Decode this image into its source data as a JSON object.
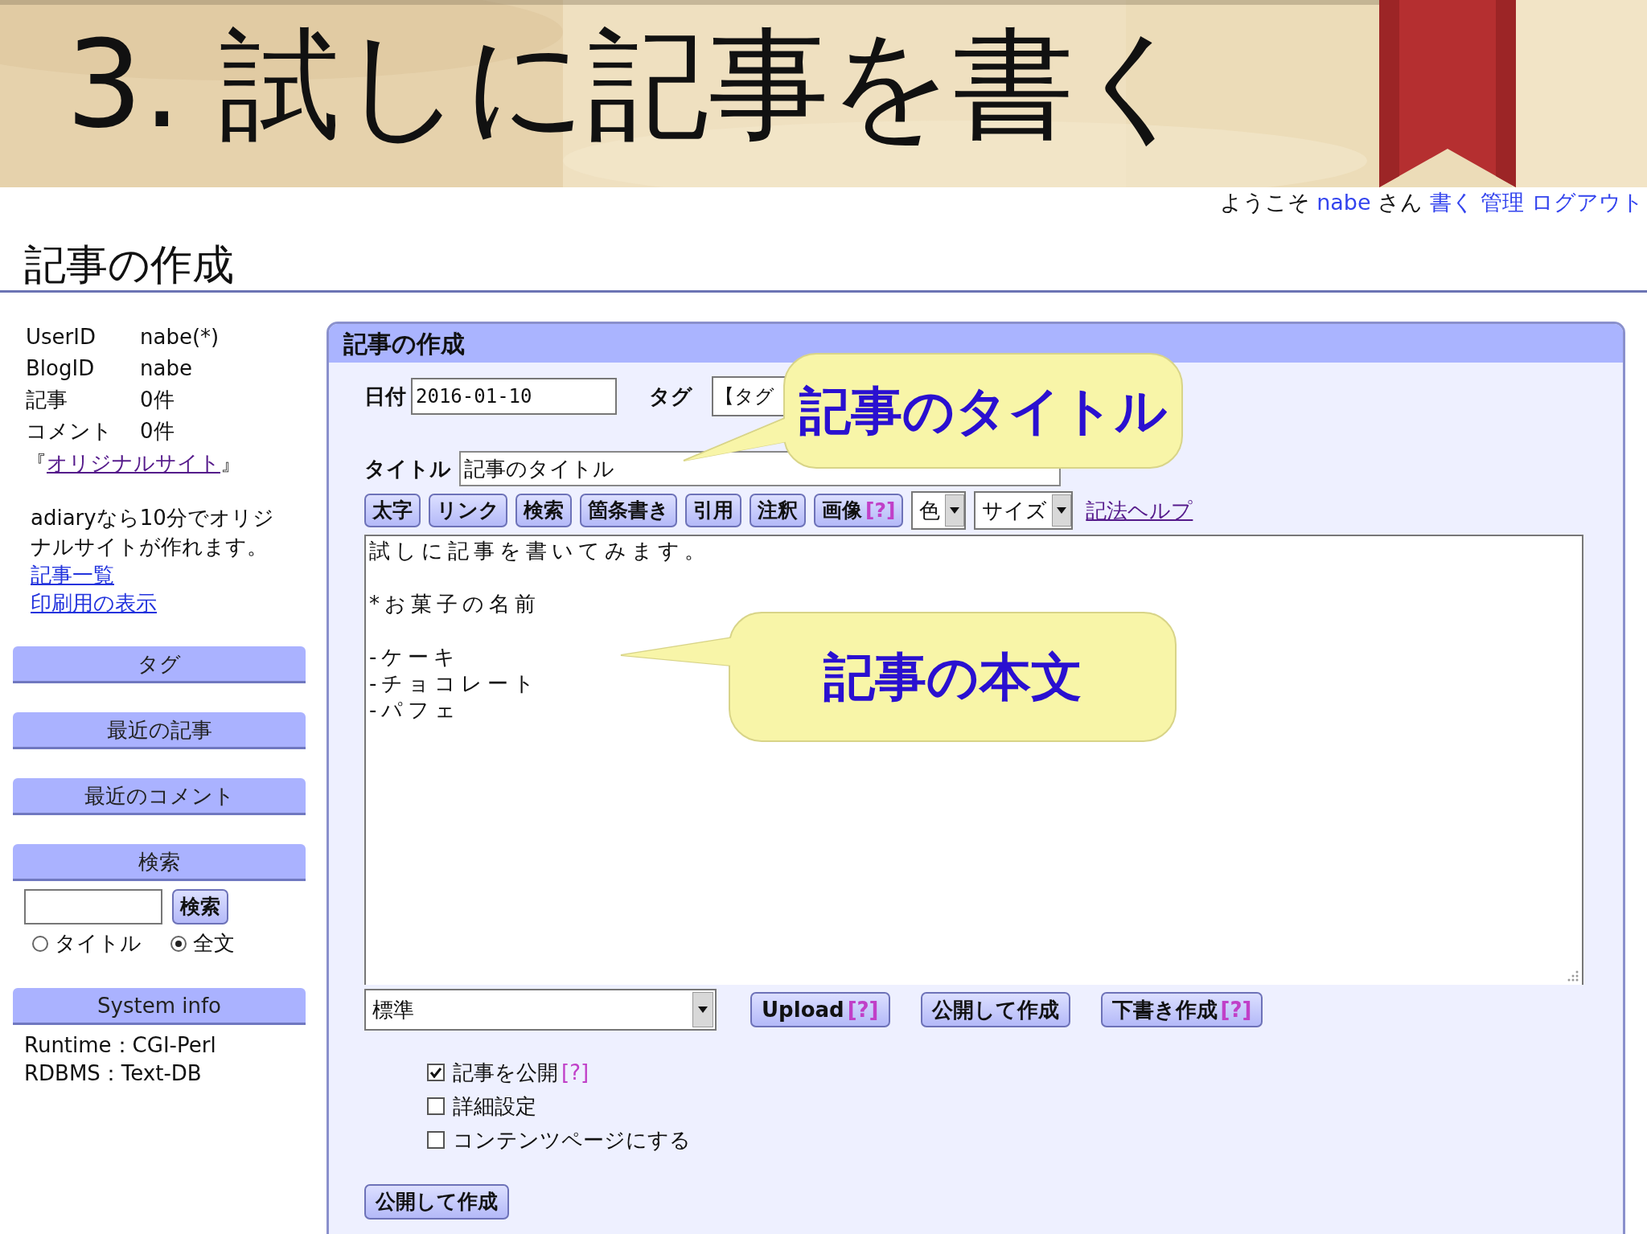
{
  "slide_title": "3. 試しに記事を書く",
  "welcome": {
    "greeting": "ようこそ",
    "user": "nabe",
    "honorific": "さん",
    "links": [
      "書く",
      "管理",
      "ログアウト"
    ]
  },
  "page_heading": "記事の作成",
  "sidebar": {
    "info": [
      {
        "key": "UserID",
        "value": "nabe(*)"
      },
      {
        "key": "BlogID",
        "value": "nabe"
      },
      {
        "key": "記事",
        "value": "0件"
      },
      {
        "key": "コメント",
        "value": "0件"
      }
    ],
    "site_link": {
      "prefix": "『",
      "link": "オリジナルサイト",
      "suffix": "』"
    },
    "description": "adiaryなら10分でオリジナルサイトが作れます。",
    "links": [
      "記事一覧",
      "印刷用の表示"
    ],
    "sections": [
      {
        "title": "タグ",
        "kind": "header"
      },
      {
        "title": "最近の記事",
        "kind": "header"
      },
      {
        "title": "最近のコメント",
        "kind": "header"
      },
      {
        "title": "検索",
        "kind": "search",
        "button": "検索",
        "options": [
          {
            "label": "タイトル",
            "selected": false
          },
          {
            "label": "全文",
            "selected": true
          }
        ]
      },
      {
        "title": "System info",
        "kind": "info",
        "lines": [
          "Runtime：CGI-Perl",
          "RDBMS：Text-DB"
        ]
      }
    ]
  },
  "panel": {
    "title": "記事の作成",
    "date_label": "日付",
    "date_value": "2016-01-10",
    "tag_label": "タグ",
    "tag_value": "【タグ",
    "title_label": "タイトル",
    "title_value": "記事のタイトル",
    "toolbar": [
      {
        "kind": "button",
        "label": "太字"
      },
      {
        "kind": "button",
        "label": "リンク"
      },
      {
        "kind": "button",
        "label": "検索"
      },
      {
        "kind": "button",
        "label": "箇条書き"
      },
      {
        "kind": "button",
        "label": "引用"
      },
      {
        "kind": "button",
        "label": "注釈"
      },
      {
        "kind": "button",
        "label": "画像",
        "help": "[?]"
      },
      {
        "kind": "select",
        "label": "色"
      },
      {
        "kind": "select",
        "label": "サイズ"
      },
      {
        "kind": "link",
        "label": "記法ヘルプ"
      }
    ],
    "body": "試しに記事を書いてみます。\n\n*お菓子の名前\n\n-ケーキ\n-チョコレート\n-パフェ",
    "format": "標準",
    "actions": [
      {
        "label": "Upload",
        "help": "[?]"
      },
      {
        "label": "公開して作成"
      },
      {
        "label": "下書き作成",
        "help": "[?]"
      }
    ],
    "options": [
      {
        "label": "記事を公開",
        "checked": true,
        "help": "[?]"
      },
      {
        "label": "詳細設定",
        "checked": false
      },
      {
        "label": "コンテンツページにする",
        "checked": false
      }
    ],
    "submit": "公開して作成"
  },
  "callouts": [
    "記事のタイトル",
    "記事の本文"
  ]
}
